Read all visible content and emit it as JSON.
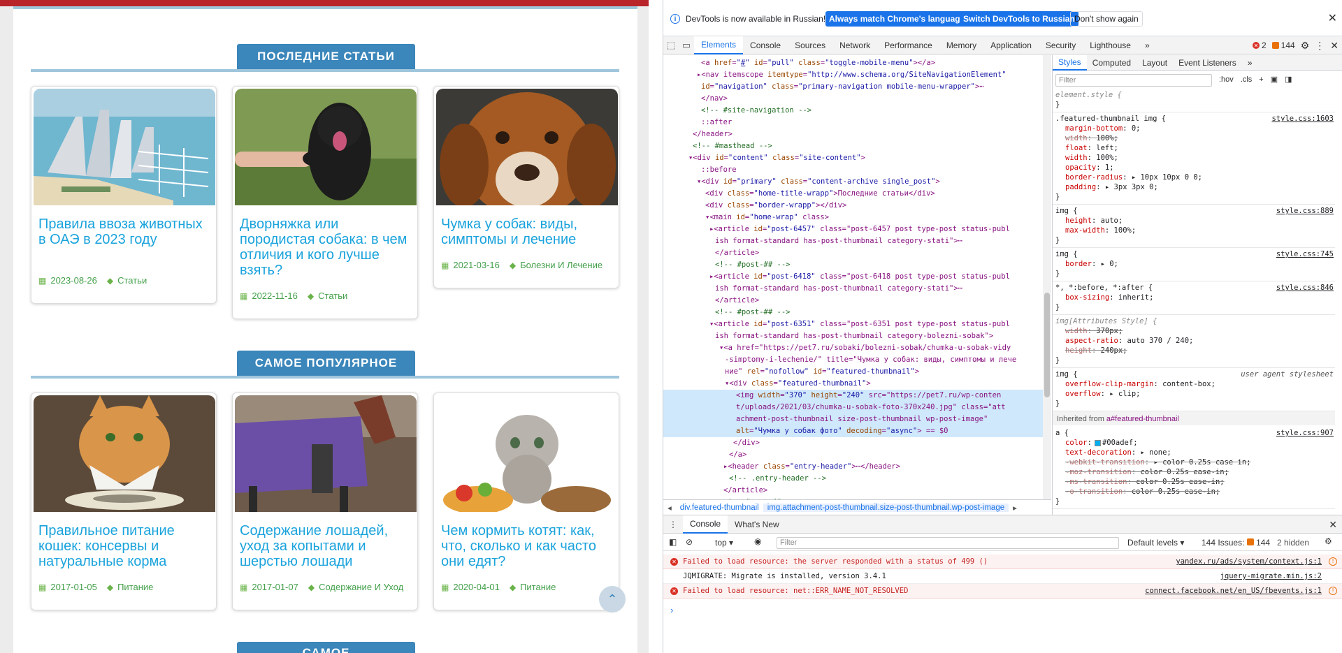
{
  "page": {
    "sections": [
      {
        "title": "ПОСЛЕДНИЕ СТАТЬИ"
      },
      {
        "title": "САМОЕ ПОПУЛЯРНОЕ"
      },
      {
        "title": "САМОЕ"
      }
    ],
    "latest": [
      {
        "title": "Правила ввоза животных в ОАЭ в 2023 году",
        "date": "2023-08-26",
        "category": "Статьи"
      },
      {
        "title": "Дворняжка или породистая собака: в чем отличия и кого лучше взять?",
        "date": "2022-11-16",
        "category": "Статьи"
      },
      {
        "title": "Чумка у собак: виды, симптомы и лечение",
        "date": "2021-03-16",
        "category": "Болезни И Лечение"
      }
    ],
    "popular": [
      {
        "title": "Правильное питание кошек: консервы и натуральные корма",
        "date": "2017-01-05",
        "category": "Питание"
      },
      {
        "title": "Содержание лошадей, уход за копытами и шерстью лошади",
        "date": "2017-01-07",
        "category": "Содержание И Уход"
      },
      {
        "title": "Чем кормить котят: как, что, сколько и как часто они едят?",
        "date": "2020-04-01",
        "category": "Питание"
      }
    ],
    "icons": {
      "date": "calendar-icon",
      "category": "tag-icon",
      "scrolltop": "chevron-up-icon"
    },
    "colors": {
      "accent": "#3b86ba",
      "link": "#1aa3dc",
      "meta": "#43a04a",
      "topbar": "#b8242a"
    }
  },
  "devtools": {
    "infobar": {
      "message": "DevTools is now available in Russian!",
      "btn_match": "Always match Chrome's language",
      "btn_switch": "Switch DevTools to Russian",
      "btn_dont": "Don't show again"
    },
    "tabs": [
      "Elements",
      "Console",
      "Sources",
      "Network",
      "Performance",
      "Memory",
      "Application",
      "Security",
      "Lighthouse"
    ],
    "more_tabs": "»",
    "errors_count": "2",
    "warnings_count": "144",
    "elements_lines": [
      "<a href=\"#\" id=\"pull\" class=\"toggle-mobile-menu\"></a>",
      "▸<nav itemscope itemtype=\"http://www.schema.org/SiteNavigationElement\"",
      "id=\"navigation\" class=\"primary-navigation mobile-menu-wrapper\">⋯",
      "</nav>",
      "<!-- #site-navigation -->",
      "::after",
      "</header>",
      "<!-- #masthead -->",
      "▾<div id=\"content\" class=\"site-content\">",
      "::before",
      "▾<div id=\"primary\" class=\"content-archive single_post\">",
      "<div class=\"home-title-wrapp\">Последние статьи</div>",
      "<div class=\"border-wrapp\"></div>",
      "▾<main id=\"home-wrap\" class>",
      "▸<article id=\"post-6457\" class=\"post-6457 post type-post status-publ",
      "ish format-standard has-post-thumbnail category-stati\">⋯",
      "</article>",
      "<!-- #post-## -->",
      "▸<article id=\"post-6418\" class=\"post-6418 post type-post status-publ",
      "ish format-standard has-post-thumbnail category-stati\">⋯",
      "</article>",
      "<!-- #post-## -->",
      "▾<article id=\"post-6351\" class=\"post-6351 post type-post status-publ",
      "ish format-standard has-post-thumbnail category-bolezni-sobak\">",
      "▾<a href=\"https://pet7.ru/sobaki/bolezni-sobak/chumka-u-sobak-vidy",
      "-simptomy-i-lechenie/\" title=\"Чумка у собак: виды, симптомы и лече",
      "ние\" rel=\"nofollow\" id=\"featured-thumbnail\">",
      "▾<div class=\"featured-thumbnail\">",
      "<img width=\"370\" height=\"240\" src=\"https://pet7.ru/wp-conten",
      "t/uploads/2021/03/chumka-u-sobak-foto-370x240.jpg\" class=\"att",
      "achment-post-thumbnail size-post-thumbnail wp-post-image\"",
      "alt=\"Чумка у собак фото\" decoding=\"async\"> == $0",
      "</div>",
      "</a>",
      "▸<header class=\"entry-header\">⋯</header>",
      "<!-- .entry-header -->",
      "</article>",
      "<!-- #post-## -->"
    ],
    "breadcrumbs": [
      "div.featured-thumbnail",
      "img.attachment-post-thumbnail.size-post-thumbnail.wp-post-image"
    ],
    "styles_tabs": [
      "Styles",
      "Computed",
      "Layout",
      "Event Listeners"
    ],
    "styles_filter_placeholder": "Filter",
    "styles_tools": [
      ":hov",
      ".cls",
      "+"
    ],
    "rules": [
      {
        "selector": "element.style {",
        "source": "",
        "props": []
      },
      {
        "selector": ".featured-thumbnail img {",
        "source": "style.css:1603",
        "props": [
          {
            "n": "margin-bottom",
            "v": "0;",
            "s": false
          },
          {
            "n": "width",
            "v": "100%;",
            "s": true
          },
          {
            "n": "float",
            "v": "left;",
            "s": false
          },
          {
            "n": "width",
            "v": "100%;",
            "s": false
          },
          {
            "n": "opacity",
            "v": "1;",
            "s": false
          },
          {
            "n": "border-radius",
            "v": "▸ 10px 10px 0 0;",
            "s": false
          },
          {
            "n": "padding",
            "v": "▸ 3px 3px 0;",
            "s": false
          }
        ]
      },
      {
        "selector": "img {",
        "source": "style.css:889",
        "props": [
          {
            "n": "height",
            "v": "auto;",
            "s": false
          },
          {
            "n": "max-width",
            "v": "100%;",
            "s": false
          }
        ]
      },
      {
        "selector": "img {",
        "source": "style.css:745",
        "props": [
          {
            "n": "border",
            "v": "▸ 0;",
            "s": false
          }
        ]
      },
      {
        "selector": "*, *:before, *:after {",
        "source": "style.css:846",
        "props": [
          {
            "n": "box-sizing",
            "v": "inherit;",
            "s": false
          }
        ]
      },
      {
        "selector": "img[Attributes Style] {",
        "source": "",
        "props": [
          {
            "n": "width",
            "v": "370px;",
            "s": true
          },
          {
            "n": "aspect-ratio",
            "v": "auto 370 / 240;",
            "s": false
          },
          {
            "n": "height",
            "v": "240px;",
            "s": true
          }
        ]
      },
      {
        "selector": "img {",
        "source": "user agent stylesheet",
        "props": [
          {
            "n": "overflow-clip-margin",
            "v": "content-box;",
            "s": false
          },
          {
            "n": "overflow",
            "v": "▸ clip;",
            "s": false
          }
        ]
      }
    ],
    "inherited_label": "Inherited from",
    "inherited_from": "a#featured-thumbnail",
    "inherited_rule": {
      "selector": "a {",
      "source": "style.css:907",
      "props": [
        {
          "n": "color",
          "v": "#00adef;",
          "s": false
        },
        {
          "n": "text-decoration",
          "v": "▸ none;",
          "s": false
        },
        {
          "n": "-webkit-transition",
          "v": "▸ color 0.25s case in;",
          "s": true
        },
        {
          "n": "-moz-transition",
          "v": "color 0.25s ease-in;",
          "s": true
        },
        {
          "n": "-ms-transition",
          "v": "color 0.25s ease-in;",
          "s": true
        },
        {
          "n": "-o-transition",
          "v": "color 0.25s ease-in;",
          "s": true
        }
      ]
    },
    "console": {
      "tabs": [
        "Console",
        "What's New"
      ],
      "context": "top",
      "filter_placeholder": "Filter",
      "levels": "Default levels",
      "issues_label": "144 Issues:",
      "issues_count": "144",
      "hidden": "2 hidden",
      "messages": [
        {
          "type": "error",
          "text": "Failed to load resource: the server responded with a status of 499 ()",
          "link": "yandex.ru/ads/system/context.js:1"
        },
        {
          "type": "log",
          "text": "JQMIGRATE: Migrate is installed, version 3.4.1",
          "link": "jquery-migrate.min.js:2"
        },
        {
          "type": "error",
          "text": "Failed to load resource: net::ERR_NAME_NOT_RESOLVED",
          "link": "connect.facebook.net/en_US/fbevents.js:1"
        }
      ],
      "prompt": "›"
    }
  }
}
